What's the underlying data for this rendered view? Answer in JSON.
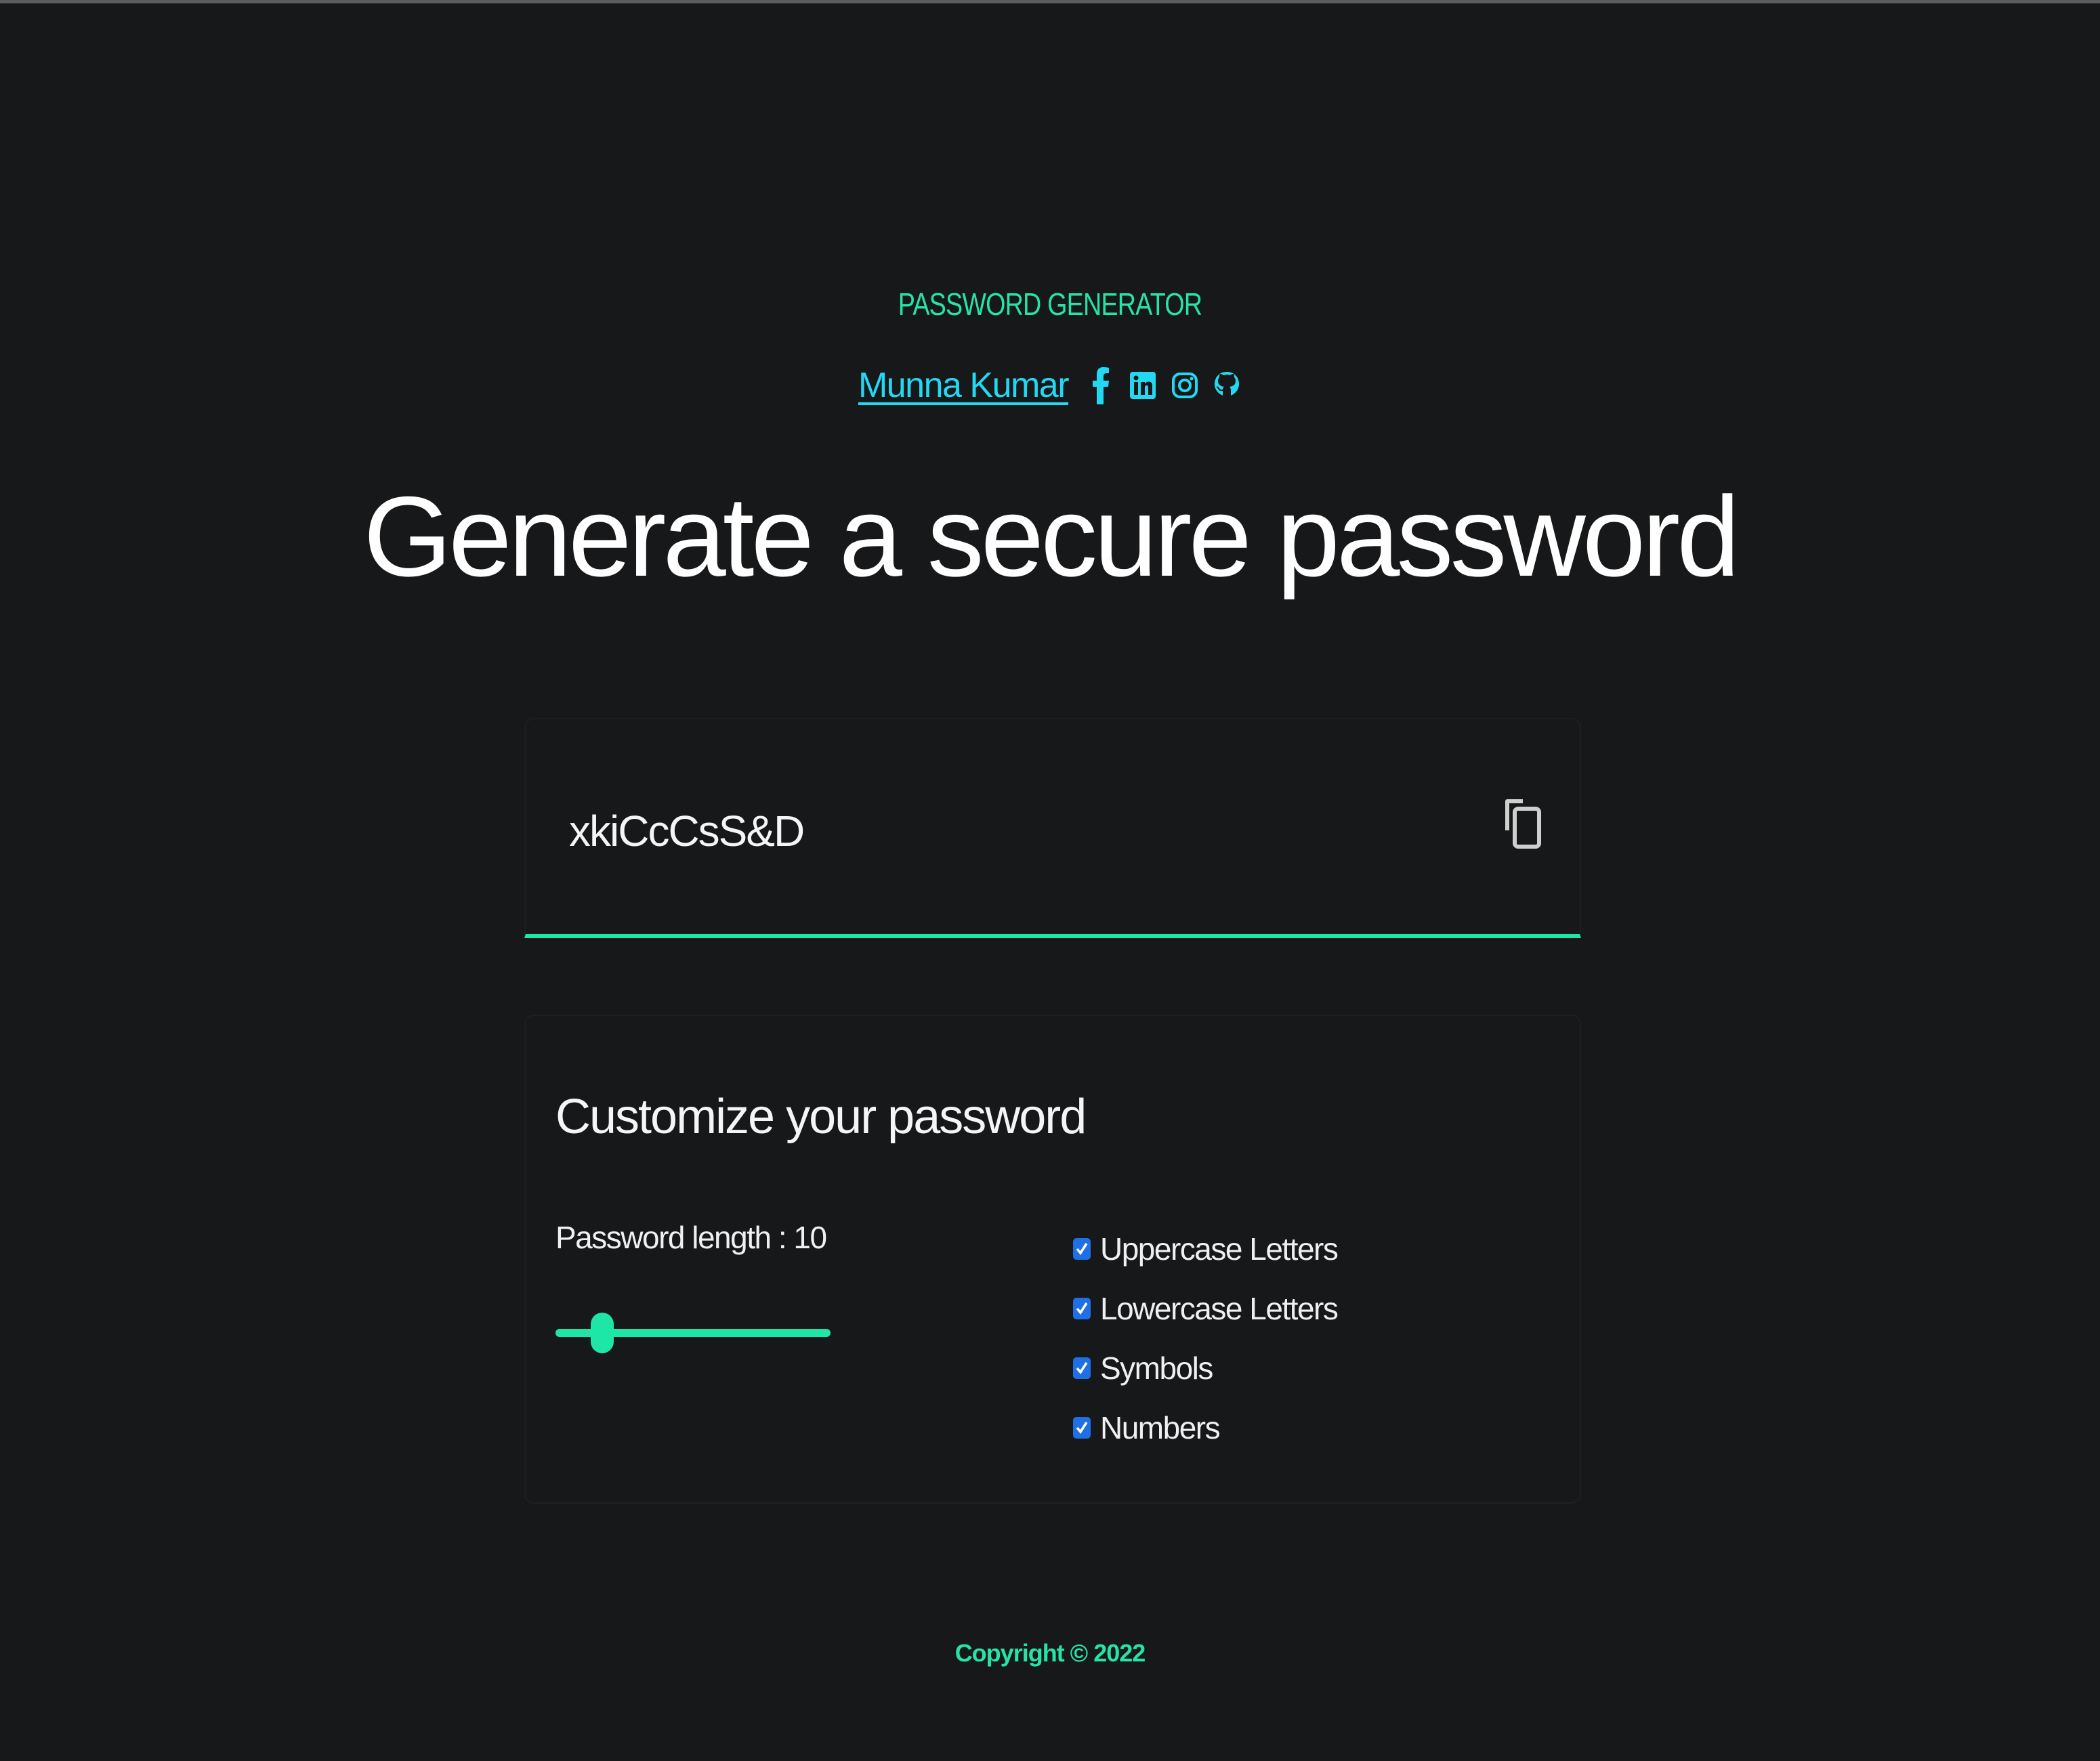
{
  "header": {
    "app_title": "PASSWORD GENERATOR",
    "author": "Munna Kumar",
    "social_icons": [
      "facebook-icon",
      "linkedin-icon",
      "instagram-icon",
      "github-icon"
    ]
  },
  "headline": "Generate a secure password",
  "password": {
    "value": "xkiCcCsS&D",
    "copy_icon": "copy-icon"
  },
  "customize": {
    "title": "Customize your password",
    "length_label": "Password length : 10",
    "length_value": 10,
    "slider_fraction": 0.17,
    "options": [
      {
        "label": "Uppercase Letters",
        "checked": true
      },
      {
        "label": "Lowercase Letters",
        "checked": true
      },
      {
        "label": "Symbols",
        "checked": true
      },
      {
        "label": "Numbers",
        "checked": true
      }
    ]
  },
  "footer": {
    "copyright": "Copyright © 2022"
  },
  "colors": {
    "background": "#17181a",
    "accent": "#1ee6a6",
    "link": "#23d9f2",
    "checkbox": "#1f6fe5"
  }
}
